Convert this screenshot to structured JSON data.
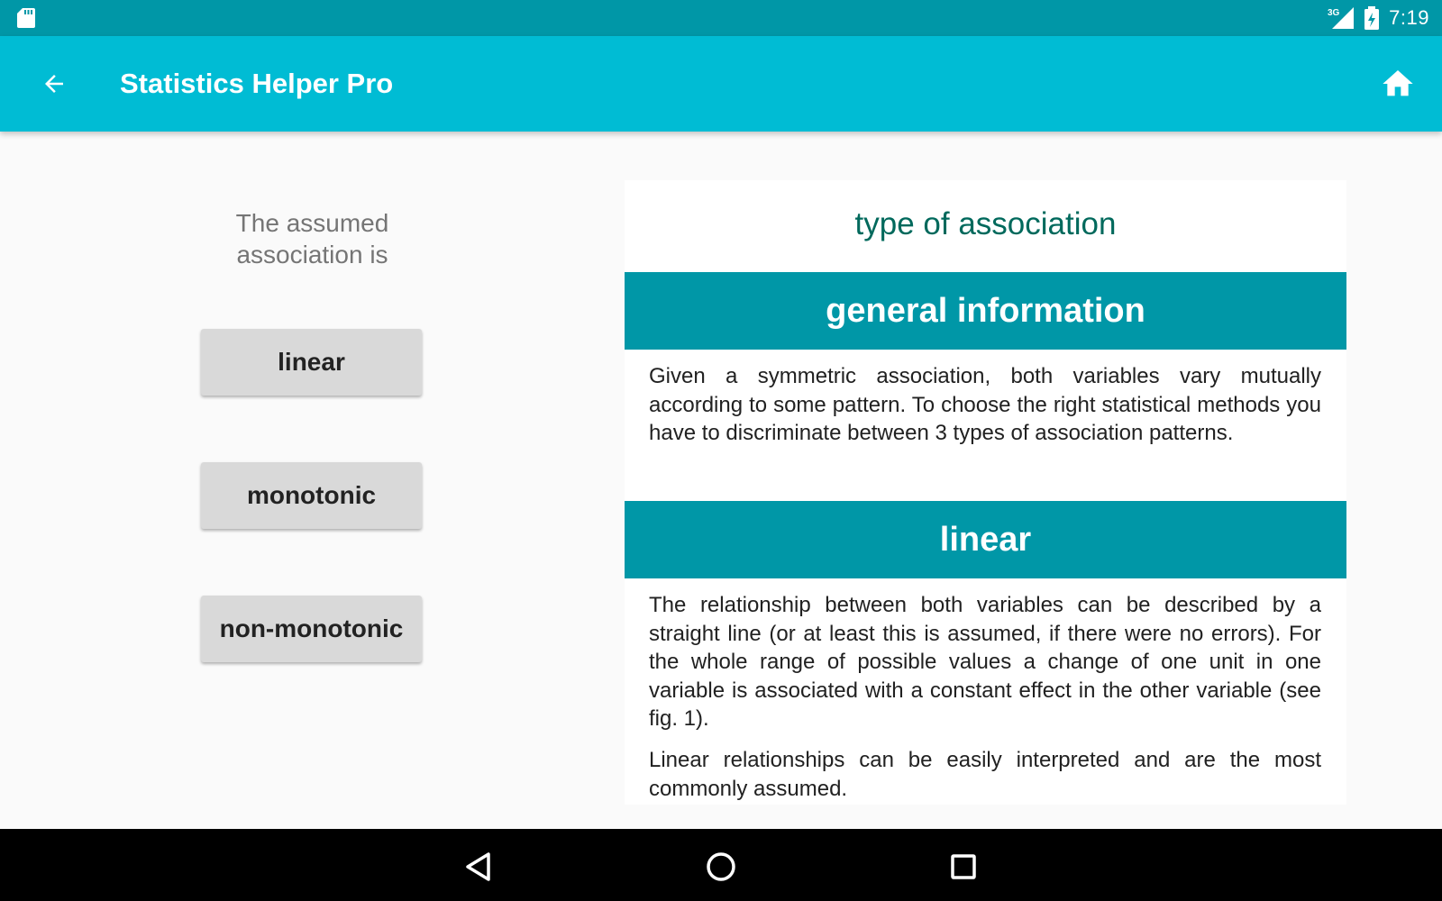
{
  "status_bar": {
    "time": "7:19",
    "network_label": "3G",
    "icons": [
      "sd-card-icon",
      "signal-3g-icon",
      "battery-charging-icon"
    ]
  },
  "app_bar": {
    "title": "Statistics Helper Pro",
    "back_icon": "arrow-back-icon",
    "home_icon": "home-icon",
    "color": "#00bcd4"
  },
  "left_panel": {
    "prompt": "The assumed association is",
    "options": [
      {
        "label": "linear"
      },
      {
        "label": "monotonic"
      },
      {
        "label": "non-monotonic"
      }
    ]
  },
  "content": {
    "title": "type of association",
    "sections": [
      {
        "header": "general information",
        "paragraphs": [
          "Given a symmetric association, both variables vary mutually according to some pattern. To choose the right statistical methods you have to discriminate between 3 types of association patterns."
        ]
      },
      {
        "header": "linear",
        "paragraphs": [
          "The relationship between both variables can be described by a straight line (or at least this is assumed, if there were no errors). For the whole range of possible values a change of one unit in one variable is associated with a constant effect in the other variable (see fig. 1).",
          "Linear relationships can be easily interpreted and are the most commonly assumed."
        ]
      }
    ]
  },
  "nav_bar": {
    "icons": [
      "nav-back-icon",
      "nav-home-icon",
      "nav-recents-icon"
    ]
  },
  "colors": {
    "status_bar": "#0097a7",
    "app_bar": "#00bcd4",
    "section_header": "#0097a7",
    "title_text": "#00695c",
    "button_bg": "#d9d9d9"
  }
}
